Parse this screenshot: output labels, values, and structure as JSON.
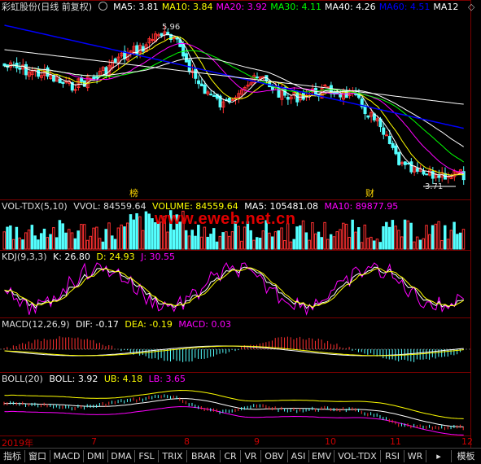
{
  "colors": {
    "ma5": "#ffffff",
    "ma10": "#ffff00",
    "ma20": "#ff00ff",
    "ma30": "#00ff00",
    "ma40": "#ffffff",
    "ma60": "#0000ff",
    "up": "#ff3030",
    "down": "#54ffff",
    "vol_label": "#ffff00",
    "vol_ma5": "#ffffff",
    "vol_ma10": "#ff00ff",
    "kdj_k": "#ffffff",
    "kdj_d": "#ffff00",
    "kdj_j": "#ff00ff",
    "macd_dif": "#ffffff",
    "macd_dea": "#ffff00",
    "macd_bar": "#ff00ff",
    "boll_mid": "#ffffff",
    "boll_ub": "#ffff00",
    "boll_lb": "#ff00ff"
  },
  "price_panel": {
    "stock_name": "彩虹股份(日线 前复权)",
    "ma": [
      {
        "label": "MA5: 3.81",
        "color": "#ffffff"
      },
      {
        "label": "MA10: 3.84",
        "color": "#ffff00"
      },
      {
        "label": "MA20: 3.92",
        "color": "#ff00ff"
      },
      {
        "label": "MA30: 4.11",
        "color": "#00ff00"
      },
      {
        "label": "MA40: 4.26",
        "color": "#ffffff"
      },
      {
        "label": "MA60: 4.51",
        "color": "#0000ff"
      },
      {
        "label": "MA12",
        "color": "#ffffff"
      }
    ],
    "high_label": "5.96",
    "low_label": "3.71",
    "marker_bang": "榜",
    "marker_cai": "财"
  },
  "volume_panel": {
    "title": "VOL-TDX(5,10)",
    "vvol": "VVOL: 84559.64",
    "volume": "VOLUME: 84559.64",
    "ma5": "MA5: 105481.08",
    "ma10": "MA10: 89877.95"
  },
  "kdj_panel": {
    "title": "KDJ(9,3,3)",
    "k": "K: 26.80",
    "d": "D: 24.93",
    "j": "J: 30.55"
  },
  "macd_panel": {
    "title": "MACD(12,26,9)",
    "dif": "DIF: -0.17",
    "dea": "DEA: -0.19",
    "macd": "MACD: 0.03"
  },
  "boll_panel": {
    "title": "BOLL(20)",
    "boll": "BOLL: 3.92",
    "ub": "UB: 4.18",
    "lb": "LB: 3.65"
  },
  "watermark": "www.eweb.net.cn",
  "timeline": [
    "2019年",
    "7",
    "8",
    "9",
    "10",
    "11",
    "12"
  ],
  "tabs": [
    "指标",
    "窗口",
    "MACD",
    "DMI",
    "DMA",
    "FSL",
    "TRIX",
    "BRAR",
    "CR",
    "VR",
    "OBV",
    "ASI",
    "EMV",
    "VOL-TDX",
    "RSI",
    "WR",
    "模板"
  ]
}
